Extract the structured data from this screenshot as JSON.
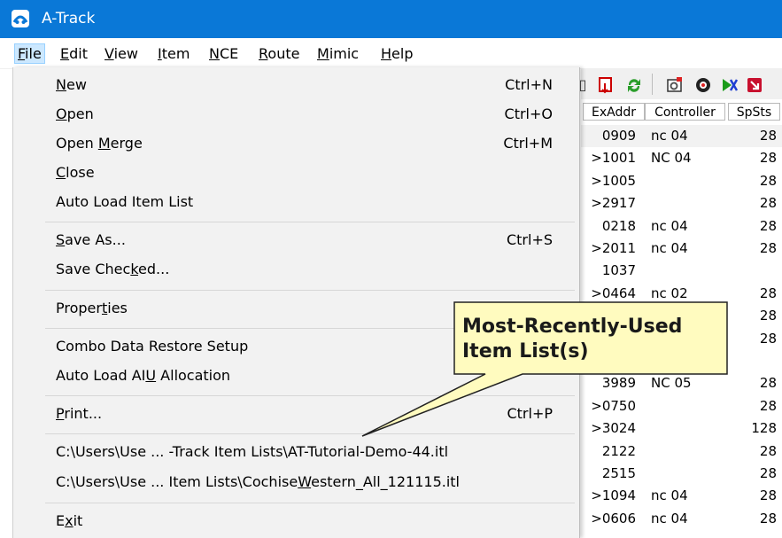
{
  "window": {
    "title": "A-Track"
  },
  "menubar": {
    "items": [
      {
        "label": "File",
        "ul": "F",
        "rest": "ile"
      },
      {
        "label": "Edit",
        "ul": "E",
        "rest": "dit"
      },
      {
        "label": "View",
        "ul": "V",
        "rest": "iew"
      },
      {
        "label": "Item",
        "ul": "I",
        "rest": "tem"
      },
      {
        "label": "NCE",
        "ul": "N",
        "rest": "CE"
      },
      {
        "label": "Route",
        "ul": "R",
        "rest": "oute"
      },
      {
        "label": "Mimic",
        "ul": "M",
        "rest": "imic"
      },
      {
        "label": "Help",
        "ul": "H",
        "rest": "elp"
      }
    ]
  },
  "file_menu": {
    "new": {
      "pre": "",
      "ul": "N",
      "post": "ew",
      "shortcut": "Ctrl+N"
    },
    "open": {
      "pre": "",
      "ul": "O",
      "post": "pen",
      "shortcut": "Ctrl+O"
    },
    "open_merge": {
      "pre": "Open ",
      "ul": "M",
      "post": "erge",
      "shortcut": "Ctrl+M"
    },
    "close": {
      "pre": "",
      "ul": "C",
      "post": "lose"
    },
    "auto_load": {
      "text": "Auto Load Item List"
    },
    "save_as": {
      "pre": "",
      "ul": "S",
      "post": "ave As...",
      "shortcut": "Ctrl+S"
    },
    "save_checked": {
      "pre": "Save Chec",
      "ul": "k",
      "post": "ed..."
    },
    "properties": {
      "pre": "Proper",
      "ul": "t",
      "post": "ies"
    },
    "combo": {
      "text": "Combo Data Restore Setup"
    },
    "aiu": {
      "pre": "Auto Load AI",
      "ul": "U",
      "post": " Allocation"
    },
    "print": {
      "pre": "",
      "ul": "P",
      "post": "rint...",
      "shortcut": "Ctrl+P"
    },
    "recent1": {
      "text": "C:\\Users\\Use ... -Track Item Lists\\AT-Tutorial-Demo-44.itl"
    },
    "recent2": {
      "pre": "C:\\Users\\Use ... Item Lists\\Cochise",
      "ul": "W",
      "post": "estern_All_121115.itl"
    },
    "exit": {
      "pre": "E",
      "ul": "x",
      "post": "it"
    }
  },
  "table": {
    "headers": [
      "ExAddr",
      "Controller",
      "SpSts"
    ],
    "rows": [
      {
        "addr": "0909",
        "ctrl": "nc 04",
        "sps": "28"
      },
      {
        "addr": ">1001",
        "ctrl": "NC 04",
        "sps": "28"
      },
      {
        "addr": ">1005",
        "ctrl": "",
        "sps": "28"
      },
      {
        "addr": ">2917",
        "ctrl": "",
        "sps": "28"
      },
      {
        "addr": "0218",
        "ctrl": "nc 04",
        "sps": "28"
      },
      {
        "addr": ">2011",
        "ctrl": "nc 04",
        "sps": "28"
      },
      {
        "addr": "1037",
        "ctrl": "",
        "sps": ""
      },
      {
        "addr": ">0464",
        "ctrl": "nc 02",
        "sps": "28"
      },
      {
        "addr": "",
        "ctrl": "",
        "sps": "28"
      },
      {
        "addr": "",
        "ctrl": "",
        "sps": "28"
      },
      {
        "addr": "",
        "ctrl": "",
        "sps": ""
      },
      {
        "addr": "3989",
        "ctrl": "NC 05",
        "sps": "28"
      },
      {
        "addr": ">0750",
        "ctrl": "",
        "sps": "28"
      },
      {
        "addr": ">3024",
        "ctrl": "",
        "sps": "128"
      },
      {
        "addr": "2122",
        "ctrl": "",
        "sps": "28"
      },
      {
        "addr": "2515",
        "ctrl": "",
        "sps": "28"
      },
      {
        "addr": ">1094",
        "ctrl": "nc 04",
        "sps": "28"
      },
      {
        "addr": ">0606",
        "ctrl": "nc 04",
        "sps": "28"
      }
    ]
  },
  "callout": {
    "line1": "Most-Recently-Used",
    "line2": "Item List(s)"
  }
}
